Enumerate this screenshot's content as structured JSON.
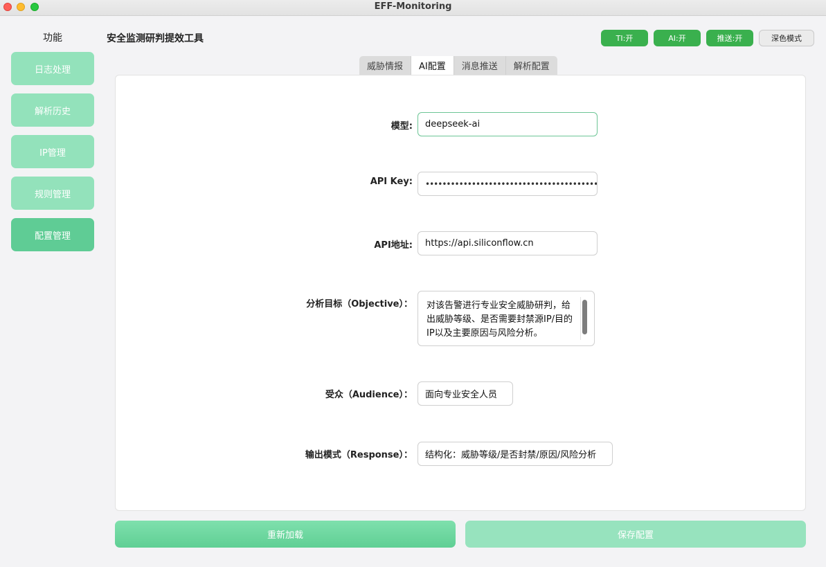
{
  "window": {
    "title": "EFF-Monitoring"
  },
  "sidebar": {
    "title": "功能",
    "items": [
      {
        "label": "日志处理"
      },
      {
        "label": "解析历史"
      },
      {
        "label": "IP管理"
      },
      {
        "label": "规则管理"
      },
      {
        "label": "配置管理",
        "active": true
      }
    ]
  },
  "header": {
    "title": "安全监测研判提效工具",
    "toggles": {
      "ti": "TI:开",
      "ai": "AI:开",
      "push": "推送:开",
      "dark_mode": "深色模式"
    }
  },
  "tabs": [
    {
      "label": "威胁情报"
    },
    {
      "label": "AI配置",
      "active": true
    },
    {
      "label": "消息推送"
    },
    {
      "label": "解析配置"
    }
  ],
  "form": {
    "model": {
      "label": "模型:",
      "value": "deepseek-ai"
    },
    "api_key": {
      "label": "API Key:",
      "value": "••••••••••••••••••••••••••••••••••••••••••••••••••••••••"
    },
    "api_url": {
      "label": "API地址:",
      "value": "https://api.siliconflow.cn"
    },
    "objective": {
      "label": "分析目标（Objective）：",
      "value": "对该告警进行专业安全威胁研判，给出威胁等级、是否需要封禁源IP/目的IP以及主要原因与风险分析。"
    },
    "audience": {
      "label": "受众（Audience）：",
      "value": "面向专业安全人员"
    },
    "response": {
      "label": "输出模式（Response）：",
      "value": "结构化：威胁等级/是否封禁/原因/风险分析"
    }
  },
  "actions": {
    "reload": "重新加载",
    "save": "保存配置"
  },
  "colors": {
    "accent_green": "#3ab04e",
    "sidebar_button": "#93e2bb",
    "sidebar_button_active": "#5fcc95"
  }
}
